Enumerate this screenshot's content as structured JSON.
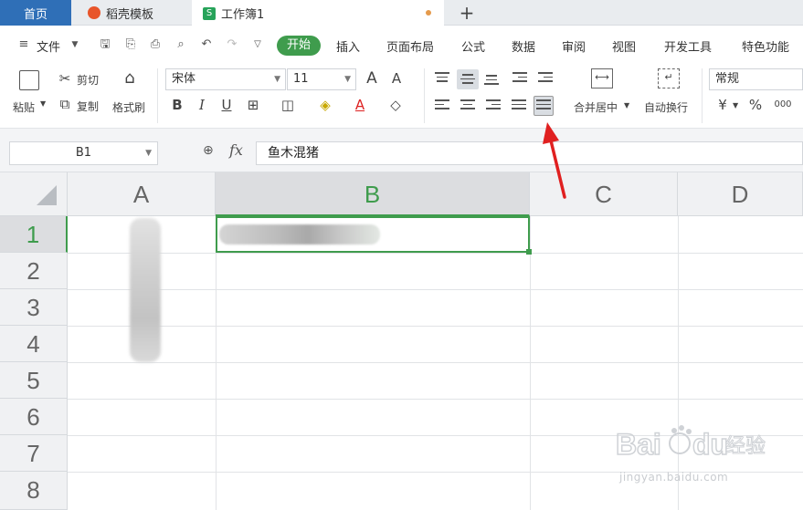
{
  "tabs": {
    "home": "首页",
    "template": "稻壳模板",
    "workbook": "工作簿1",
    "workbook_icon": "S",
    "add": "+"
  },
  "menu": {
    "file": "文件",
    "items": [
      "开始",
      "插入",
      "页面布局",
      "公式",
      "数据",
      "审阅",
      "视图",
      "开发工具",
      "特色功能"
    ]
  },
  "ribbon": {
    "paste": "粘贴",
    "cut": "剪切",
    "copy": "复制",
    "format_painter": "格式刷",
    "font_name": "宋体",
    "font_size": "11",
    "bold": "B",
    "italic": "I",
    "underline": "U",
    "merge_center": "合并居中",
    "wrap_text": "自动换行",
    "number_format": "常规",
    "currency": "¥",
    "percent": "%",
    "thousands": "000",
    "font_grow": "A",
    "font_shrink": "A",
    "font_color": "A"
  },
  "formula": {
    "cell_ref": "B1",
    "fx": "fx",
    "value": "鱼木混猪"
  },
  "grid": {
    "columns": [
      "A",
      "B",
      "C",
      "D"
    ],
    "rows": [
      "1",
      "2",
      "3",
      "4",
      "5",
      "6",
      "7",
      "8"
    ],
    "selected_cell": "B1"
  },
  "watermark": {
    "logo": "Bai du 经验",
    "url": "jingyan.baidu.com"
  },
  "colors": {
    "accent": "#3f9c4d",
    "home_tab": "#2f6fb7",
    "annotation_arrow": "#e02020"
  }
}
